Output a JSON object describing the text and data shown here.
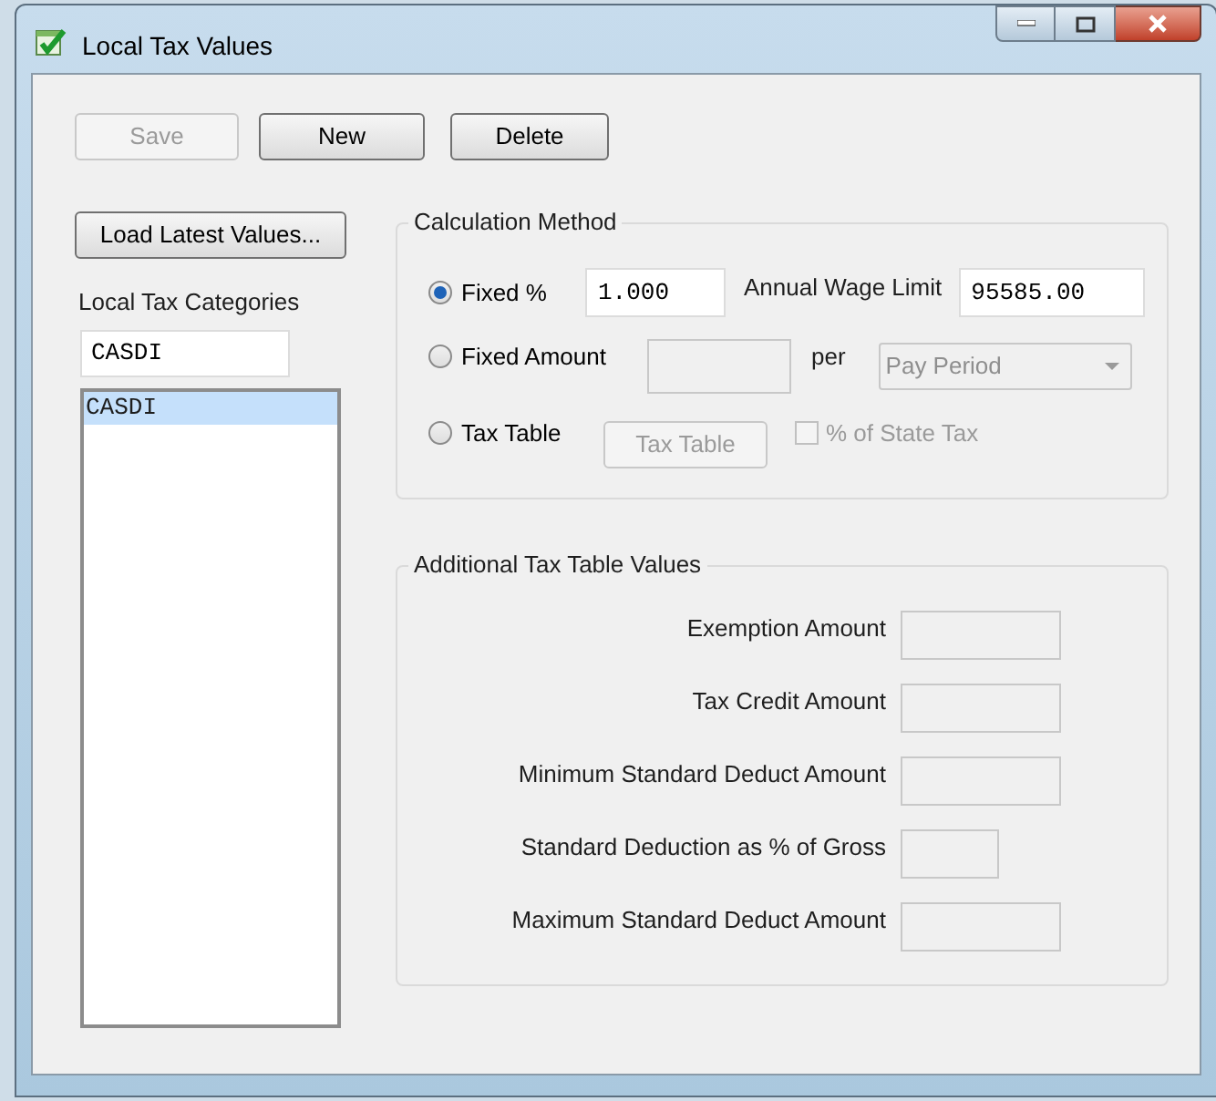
{
  "window": {
    "title": "Local Tax Values"
  },
  "toolbar": [
    {
      "label": "Save",
      "disabled": true
    },
    {
      "label": "New",
      "disabled": false
    },
    {
      "label": "Delete",
      "disabled": false
    }
  ],
  "load_button": {
    "label": "Load Latest Values..."
  },
  "categories": {
    "label": "Local Tax Categories",
    "value": "CASDI",
    "items": [
      {
        "label": "CASDI",
        "selected": true
      }
    ]
  },
  "calculation_method": {
    "title": "Calculation Method",
    "options": [
      {
        "label": "Fixed %",
        "selected": true
      },
      {
        "label": "Fixed Amount",
        "selected": false
      },
      {
        "label": "Tax Table",
        "selected": false
      }
    ],
    "fixed_percent": {
      "value": "1.000",
      "disabled": false
    },
    "annual_wage_limit": {
      "label": "Annual Wage Limit",
      "value": "95585.00"
    },
    "fixed_amount": {
      "disabled": true
    },
    "per_label": "per",
    "per_dropdown": {
      "value": "Pay Period",
      "disabled": true
    },
    "tax_table_button": {
      "label": "Tax Table",
      "disabled": true
    },
    "percent_of_state_tax": {
      "label": "% of State Tax",
      "checked": false,
      "disabled": true
    }
  },
  "additional": {
    "title": "Additional Tax Table Values",
    "fields": [
      {
        "label": "Exemption Amount",
        "kind": "amount",
        "disabled": true
      },
      {
        "label": "Tax Credit Amount",
        "kind": "amount",
        "disabled": true
      },
      {
        "label": "Minimum Standard Deduct Amount",
        "kind": "amount",
        "disabled": true
      },
      {
        "label": "Standard Deduction as % of Gross",
        "kind": "percent",
        "disabled": true
      },
      {
        "label": "Maximum Standard Deduct Amount",
        "kind": "amount",
        "disabled": true
      }
    ]
  }
}
